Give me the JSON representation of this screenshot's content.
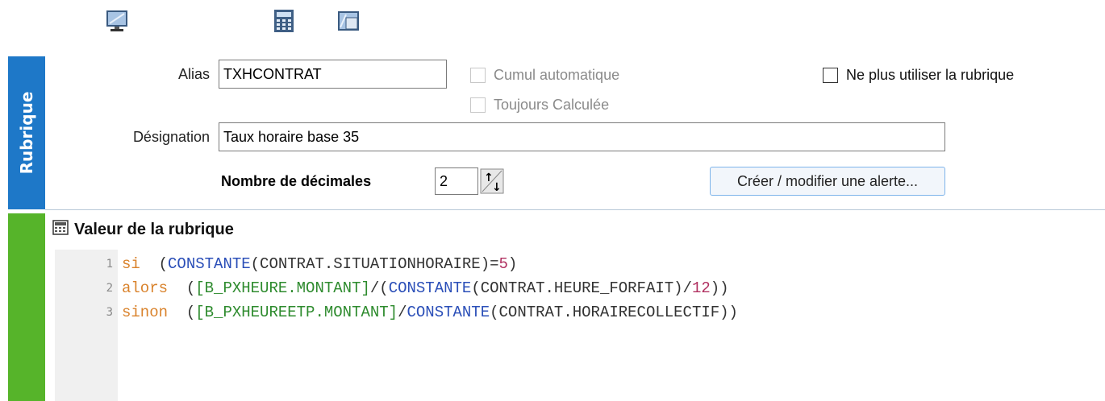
{
  "toolbar": {
    "icons": [
      "monitor-icon",
      "calculator-icon",
      "window-icon"
    ]
  },
  "sidebar": {
    "section_label": "Rubrique",
    "colors": {
      "rubrique": "#1e78c8",
      "valeur": "#56b42a"
    }
  },
  "form": {
    "alias_label": "Alias",
    "alias_value": "TXHCONTRAT",
    "cumul_label": "Cumul automatique",
    "toujours_label": "Toujours Calculée",
    "ne_plus_label": "Ne plus utiliser la rubrique",
    "designation_label": "Désignation",
    "designation_value": "Taux horaire base 35",
    "decimales_label": "Nombre de décimales",
    "decimales_value": "2",
    "alert_button_label": "Créer / modifier une alerte..."
  },
  "valeur": {
    "title": "Valeur de la rubrique",
    "lines": [
      {
        "num": "1",
        "tokens": [
          {
            "t": "si",
            "c": "kw"
          },
          {
            "t": "  (",
            "c": "tx"
          },
          {
            "t": "CONSTANTE",
            "c": "fn"
          },
          {
            "t": "(CONTRAT.SITUATIONHORAIRE)=",
            "c": "tx"
          },
          {
            "t": "5",
            "c": "num"
          },
          {
            "t": ")",
            "c": "tx"
          }
        ]
      },
      {
        "num": "2",
        "tokens": [
          {
            "t": "alors",
            "c": "kw"
          },
          {
            "t": "  (",
            "c": "tx"
          },
          {
            "t": "[B_PXHEURE.MONTANT]",
            "c": "ref"
          },
          {
            "t": "/(",
            "c": "tx"
          },
          {
            "t": "CONSTANTE",
            "c": "fn"
          },
          {
            "t": "(CONTRAT.HEURE_FORFAIT)/",
            "c": "tx"
          },
          {
            "t": "12",
            "c": "num"
          },
          {
            "t": "))",
            "c": "tx"
          }
        ]
      },
      {
        "num": "3",
        "tokens": [
          {
            "t": "sinon",
            "c": "kw"
          },
          {
            "t": "  (",
            "c": "tx"
          },
          {
            "t": "[B_PXHEUREETP.MONTANT]",
            "c": "ref"
          },
          {
            "t": "/",
            "c": "tx"
          },
          {
            "t": "CONSTANTE",
            "c": "fn"
          },
          {
            "t": "(CONTRAT.HORAIRECOLLECTIF))",
            "c": "tx"
          }
        ]
      }
    ]
  }
}
